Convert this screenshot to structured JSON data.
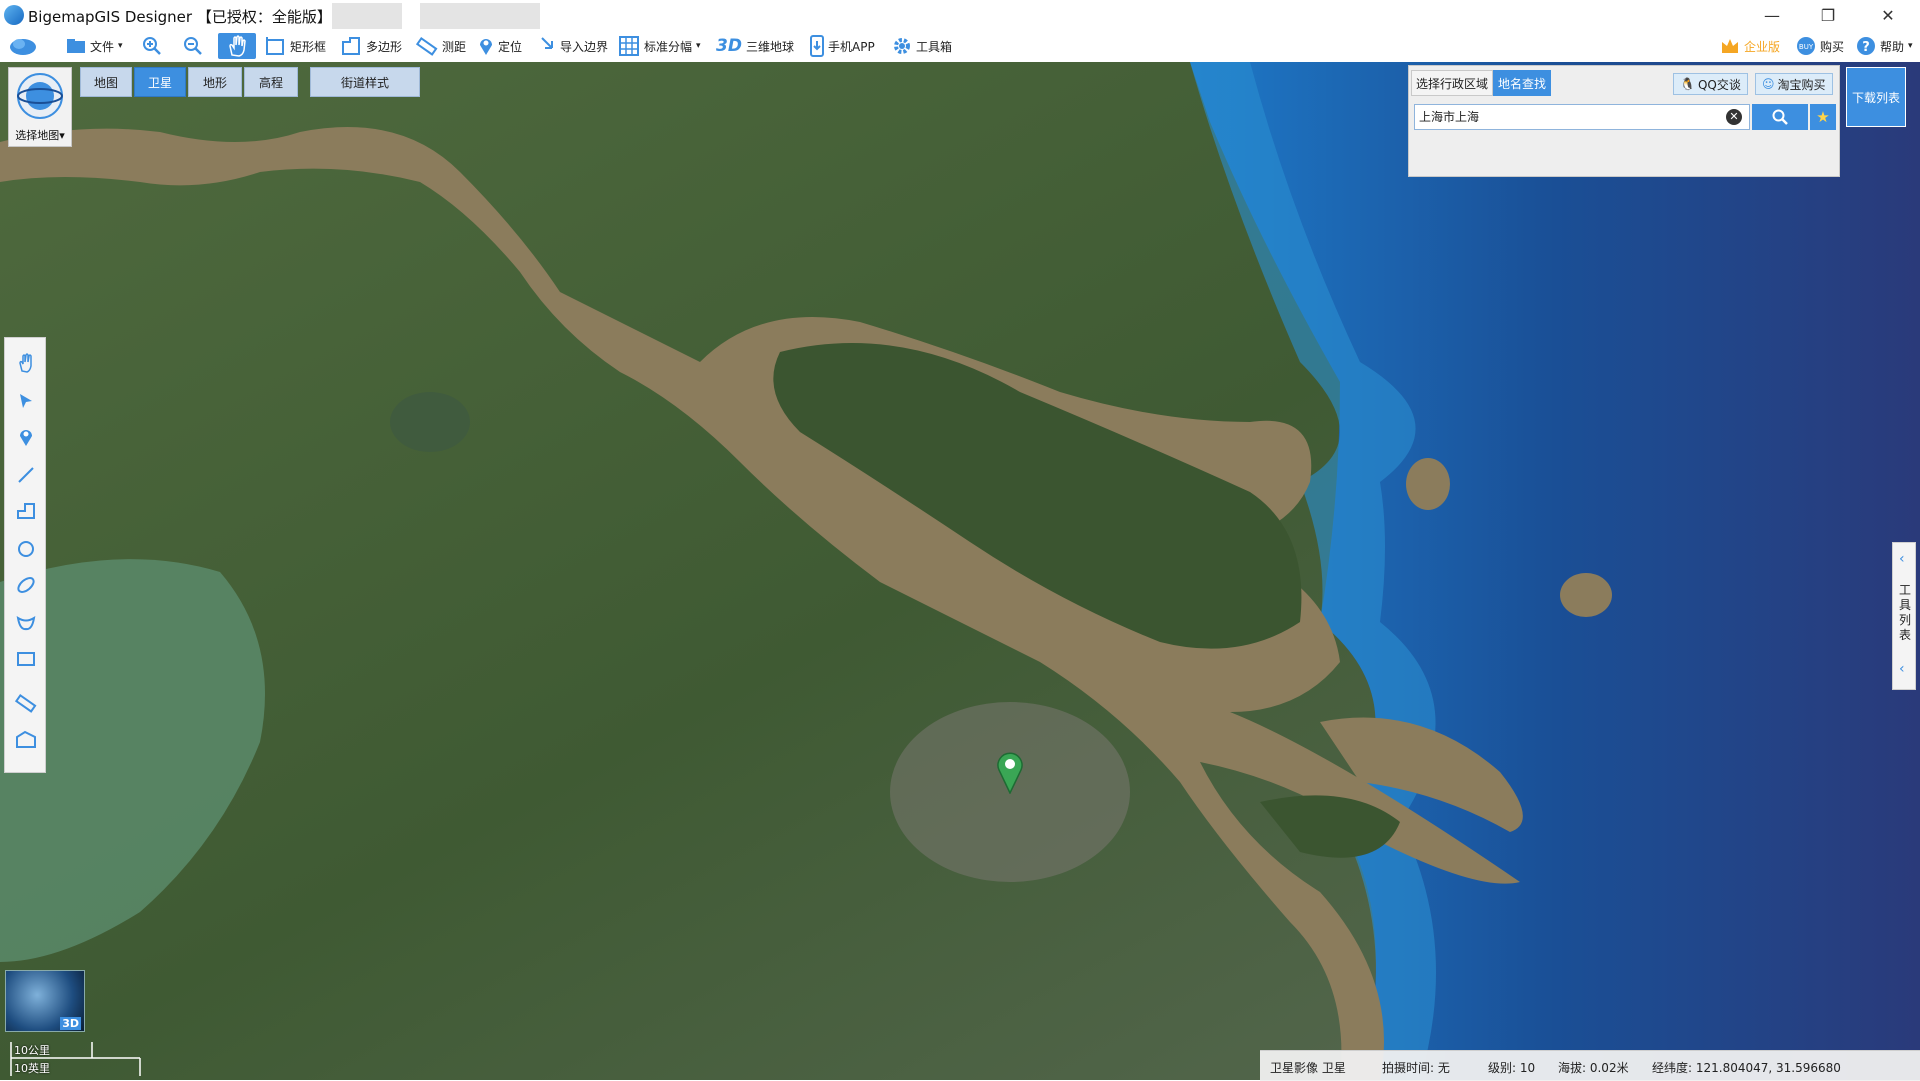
{
  "window": {
    "title": "BigemapGIS Designer 【已授权：全能版】",
    "controls": {
      "minimize": "—",
      "restore": "❐",
      "close": "✕"
    }
  },
  "toolbar": {
    "file": "文件",
    "rect": "矩形框",
    "polygon": "多边形",
    "measure": "测距",
    "locate": "定位",
    "import_boundary": "导入边界",
    "grid": "标准分幅",
    "globe_3d_badge": "3D",
    "globe_3d": "三维地球",
    "mobile_app": "手机APP",
    "toolbox": "工具箱",
    "enterprise": "企业版",
    "buy": "购买",
    "help": "帮助"
  },
  "map_types": {
    "map": "地图",
    "satellite": "卫星",
    "terrain": "地形",
    "elevation": "高程",
    "street_style": "街道样式",
    "selected": "卫星"
  },
  "select_map": {
    "label": "选择地图"
  },
  "search_panel": {
    "tab_admin": "选择行政区域",
    "tab_place": "地名查找",
    "qq": "QQ交谈",
    "taobao": "淘宝购买",
    "query": "上海市上海"
  },
  "download_list": "下载列表",
  "tool_list": "工具列表",
  "globe_thumb_badge": "3D",
  "scalebar": {
    "km": "10公里",
    "mi": "10英里"
  },
  "status": {
    "source": "卫星影像 卫星",
    "capture_time": "拍摄时间: 无",
    "level": "级别:  10",
    "altitude": "海拔: 0.02米",
    "coords": "经纬度:  121.804047, 31.596680"
  },
  "icons": [
    "app-logo-icon",
    "file-icon",
    "zoom-in-icon",
    "zoom-out-icon",
    "hand-icon",
    "rect-icon",
    "polygon-icon",
    "ruler-icon",
    "pin-icon",
    "import-icon",
    "grid-icon",
    "phone-icon",
    "gear-icon",
    "crown-icon",
    "buy-icon",
    "help-icon",
    "search-icon",
    "star-icon",
    "map-marker-icon"
  ],
  "colors": {
    "accent": "#3d8fe0",
    "marker": "#3aa655"
  }
}
